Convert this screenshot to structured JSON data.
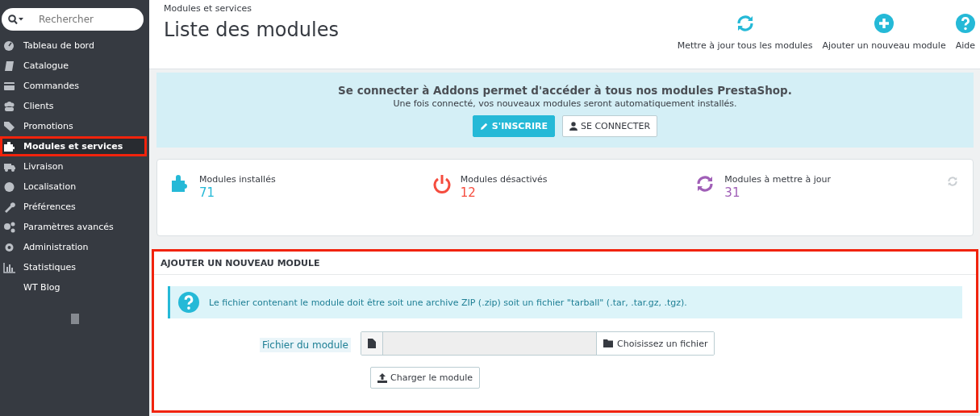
{
  "sidebar": {
    "search": {
      "placeholder": "Rechercher"
    },
    "items": [
      {
        "label": "Tableau de bord",
        "selected": false,
        "highlighted": false
      },
      {
        "label": "Catalogue",
        "selected": false,
        "highlighted": false
      },
      {
        "label": "Commandes",
        "selected": false,
        "highlighted": false
      },
      {
        "label": "Clients",
        "selected": false,
        "highlighted": false
      },
      {
        "label": "Promotions",
        "selected": false,
        "highlighted": false
      },
      {
        "label": "Modules et services",
        "selected": true,
        "highlighted": true
      },
      {
        "label": "Livraison",
        "selected": false,
        "highlighted": false
      },
      {
        "label": "Localisation",
        "selected": false,
        "highlighted": false
      },
      {
        "label": "Préférences",
        "selected": false,
        "highlighted": false
      },
      {
        "label": "Paramètres avancés",
        "selected": false,
        "highlighted": false
      },
      {
        "label": "Administration",
        "selected": false,
        "highlighted": false
      },
      {
        "label": "Statistiques",
        "selected": false,
        "highlighted": false
      },
      {
        "label": "WT Blog",
        "selected": false,
        "highlighted": false
      }
    ]
  },
  "header": {
    "breadcrumb": "Modules et services",
    "title": "Liste des modules",
    "actions": [
      {
        "label": "Mettre à jour tous les modules",
        "kind": "refresh"
      },
      {
        "label": "Ajouter un nouveau module",
        "kind": "add"
      },
      {
        "label": "Aide",
        "kind": "help"
      }
    ]
  },
  "banner": {
    "title": "Se connecter à Addons permet d'accéder à tous nos modules PrestaShop.",
    "subtitle": "Une fois connecté, vos nouveaux modules seront automatiquement installés.",
    "buttons": [
      {
        "label": "S'INSCRIRE",
        "kind": "primary"
      },
      {
        "label": "SE CONNECTER",
        "kind": "default"
      }
    ]
  },
  "stats": [
    {
      "label": "Modules installés",
      "value": "71",
      "color": "#25b9d7",
      "kind": "puzzle"
    },
    {
      "label": "Modules désactivés",
      "value": "12",
      "color": "#f54c3e",
      "kind": "power"
    },
    {
      "label": "Modules à mettre à jour",
      "value": "31",
      "color": "#a05fb7",
      "kind": "refresh"
    }
  ],
  "upload_panel": {
    "title": "AJOUTER UN NOUVEAU MODULE",
    "highlighted": true,
    "info": "Le fichier contenant le module doit être soit une archive ZIP (.zip) soit un fichier \"tarball\" (.tar, .tar.gz, .tgz).",
    "file_label": "Fichier du module",
    "choose_button": "Choisissez un fichier",
    "upload_button": "Charger le module"
  }
}
